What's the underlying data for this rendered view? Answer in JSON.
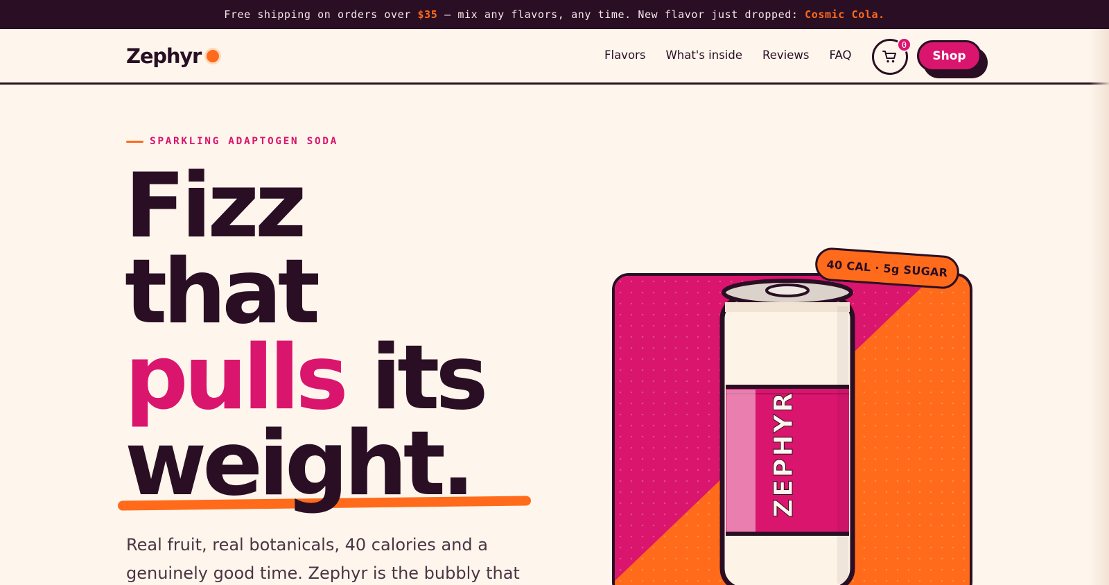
{
  "announcement": {
    "prefix": "Free shipping on orders over ",
    "amount": "$35",
    "middle": " — mix any flavors, any time. New flavor just dropped: ",
    "flavor": "Cosmic Cola."
  },
  "header": {
    "logo": "Zephyr",
    "nav": [
      "Flavors",
      "What's inside",
      "Reviews",
      "FAQ"
    ],
    "cart_count": "0",
    "shop_label": "Shop"
  },
  "hero": {
    "eyebrow": "SPARKLING ADAPTOGEN SODA",
    "headline": {
      "line1": "Fizz",
      "line2": "that",
      "line3_pink": "pulls",
      "line3_rest": "its",
      "line4": "weight."
    },
    "subtext": "Real fruit, real botanicals, 40 calories and a genuinely good time. Zephyr is the bubbly that",
    "can_label": "ZEPHYR",
    "nutrition_tag": "40 CAL · 5g SUGAR"
  },
  "colors": {
    "ink": "#2A0F24",
    "pink": "#D9156E",
    "orange": "#FF6B1A",
    "cream": "#FEF5EC"
  },
  "icons": [
    "cart-icon",
    "logo-dot-icon"
  ]
}
